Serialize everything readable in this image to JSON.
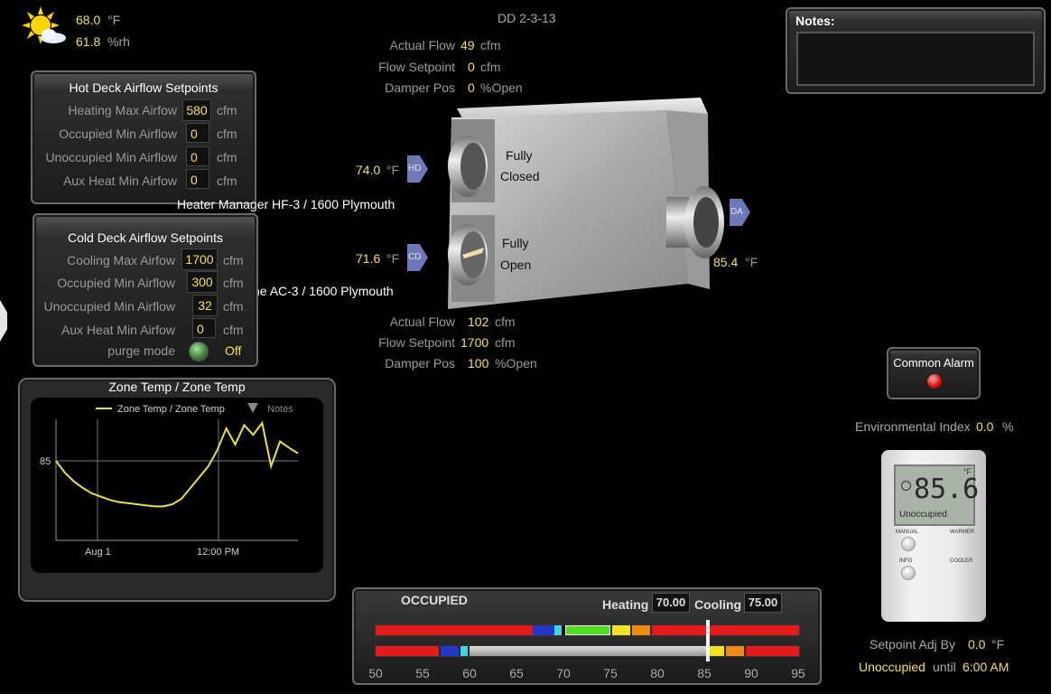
{
  "header": {
    "title": "DD 2-3-13"
  },
  "weather": {
    "icon": "sun-cloud-icon",
    "temp": "68.0",
    "temp_unit": "°F",
    "humidity": "61.8",
    "humidity_unit": "%rh"
  },
  "hot_deck": {
    "title": "Hot Deck Airflow Setpoints",
    "rows": [
      {
        "label": "Heating Max Airfow",
        "value": "580",
        "unit": "cfm"
      },
      {
        "label": "Occupied Min Airflow",
        "value": "0",
        "unit": "cfm"
      },
      {
        "label": "Unoccupied Min Airflow",
        "value": "0",
        "unit": "cfm"
      },
      {
        "label": "Aux Heat Min Airfow",
        "value": "0",
        "unit": "cfm"
      }
    ]
  },
  "cold_deck": {
    "title": "Cold Deck Airflow Setpoints",
    "rows": [
      {
        "label": "Cooling Max Airfow",
        "value": "1700",
        "unit": "cfm"
      },
      {
        "label": "Occupied Min Airflow",
        "value": "300",
        "unit": "cfm"
      },
      {
        "label": "Unoccupied Min Airflow",
        "value": "32",
        "unit": "cfm"
      },
      {
        "label": "Aux Heat Min Airfow",
        "value": "0",
        "unit": "cfm"
      }
    ],
    "purge_label": "purge mode",
    "purge_value": "Off"
  },
  "overlay_labels": {
    "heater": "Heater Manager HF-3 / 1600 Plymouth",
    "cooling": "ne AC-3 / 1600 Plymouth"
  },
  "hot_flow": {
    "actual_label": "Actual Flow",
    "actual": "49",
    "actual_unit": "cfm",
    "setpoint_label": "Flow Setpoint",
    "setpoint": "0",
    "setpoint_unit": "cfm",
    "damper_label": "Damper Pos",
    "damper": "0",
    "damper_unit": "%Open"
  },
  "cold_flow": {
    "actual_label": "Actual Flow",
    "actual": "102",
    "actual_unit": "cfm",
    "setpoint_label": "Flow Setpoint",
    "setpoint": "1700",
    "setpoint_unit": "cfm",
    "damper_label": "Damper Pos",
    "damper": "100",
    "damper_unit": "%Open"
  },
  "unit": {
    "hd_temp": "74.0",
    "hd_unit": "°F",
    "hd_tag": "HD",
    "cd_temp": "71.6",
    "cd_unit": "°F",
    "cd_tag": "CD",
    "da_temp": "85.4",
    "da_unit": "°F",
    "da_tag": "DA",
    "hot_state_1": "Fully",
    "hot_state_2": "Closed",
    "cold_state_1": "Fully",
    "cold_state_2": "Open"
  },
  "trend": {
    "title": "Zone Temp / Zone Temp",
    "legend": "Zone Temp / Zone Temp",
    "notes": "Notes",
    "ytick": "85",
    "xticks": [
      "Aug 1",
      "12:00 PM"
    ]
  },
  "chart_data": {
    "type": "line",
    "title": "Zone Temp / Zone Temp",
    "series": [
      {
        "name": "Zone Temp / Zone Temp",
        "values": [
          85.0,
          83.9,
          83.1,
          82.5,
          82.0,
          81.7,
          81.4,
          81.2,
          81.1,
          81.0,
          80.9,
          80.8,
          80.8,
          81.0,
          81.5,
          82.5,
          83.5,
          84.5,
          86.0,
          88.0,
          86.5,
          88.3,
          87.4,
          88.5,
          84.5,
          86.8,
          86.2,
          85.7
        ]
      }
    ],
    "yticks": [
      "85"
    ],
    "xticks": [
      "Aug 1",
      "12:00 PM"
    ],
    "grid": true
  },
  "notes": {
    "label": "Notes:"
  },
  "alarm": {
    "label": "Common Alarm"
  },
  "env": {
    "label": "Environmental Index",
    "value": "0.0",
    "unit": "%"
  },
  "thermostat": {
    "reading": "85.6",
    "unit": "°F",
    "status": "Unoccupied",
    "manual": "MANUAL",
    "warmer": "WARMER",
    "info": "INFO",
    "cooler": "COOLER"
  },
  "setpoint_adj": {
    "label": "Setpoint Adj By",
    "value": "0.0",
    "unit": "°F"
  },
  "schedule": {
    "status": "Unoccupied",
    "until": "until",
    "time": "6:00 AM"
  },
  "occupancy": {
    "mode": "OCCUPIED",
    "heating_label": "Heating",
    "heating_value": "70.00",
    "cooling_label": "Cooling",
    "cooling_value": "75.00",
    "scale": [
      "50",
      "55",
      "60",
      "65",
      "70",
      "75",
      "80",
      "85",
      "90",
      "95"
    ],
    "current_temp_marker": 85.4
  }
}
